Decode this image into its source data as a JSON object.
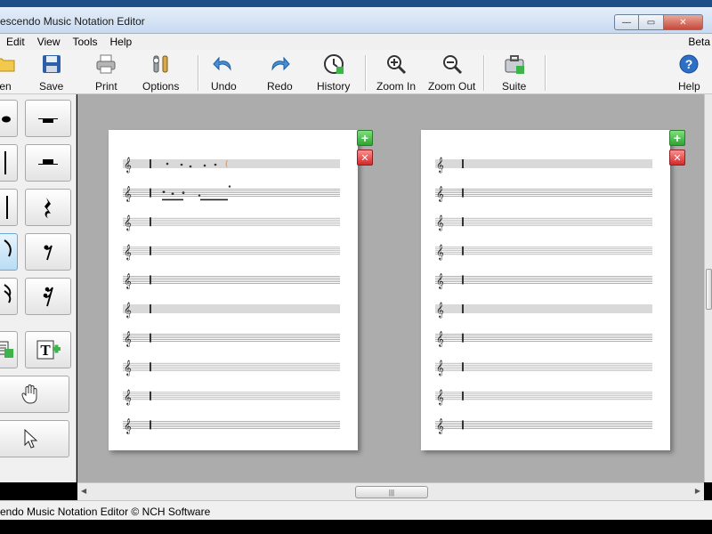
{
  "window": {
    "title": "escendo Music Notation Editor",
    "btn_minimize": "—",
    "btn_maximize": "▭",
    "btn_close": "✕"
  },
  "menu": {
    "items": [
      "Edit",
      "View",
      "Tools",
      "Help"
    ],
    "right": "Beta"
  },
  "toolbar": {
    "open": "en",
    "save": "Save",
    "print": "Print",
    "options": "Options",
    "undo": "Undo",
    "redo": "Redo",
    "history": "History",
    "zoom_in": "Zoom In",
    "zoom_out": "Zoom Out",
    "suite": "Suite",
    "help": "Help"
  },
  "palette": {
    "tools": [
      "quarter-note",
      "whole-rest",
      "half-note",
      "half-rest",
      "whole-note",
      "quarter-rest",
      "eighth-note",
      "eighth-rest",
      "sixteenth-note",
      "sixteenth-rest",
      "add-staff",
      "add-text",
      "hand-pan",
      "pointer"
    ],
    "selected": "eighth-note"
  },
  "score": {
    "pages": 2,
    "staves_per_page": 10,
    "page_add_label": "+",
    "page_remove_label": "✕"
  },
  "scroll": {
    "grip": "|||",
    "left_arrow": "◀",
    "right_arrow": "▶"
  },
  "colors": {
    "title_band": "#1c4f86",
    "page_add": "#2ea42e",
    "page_remove": "#d12a2a",
    "workspace": "#acacac"
  },
  "status": {
    "text": "endo Music Notation Editor © NCH Software"
  }
}
